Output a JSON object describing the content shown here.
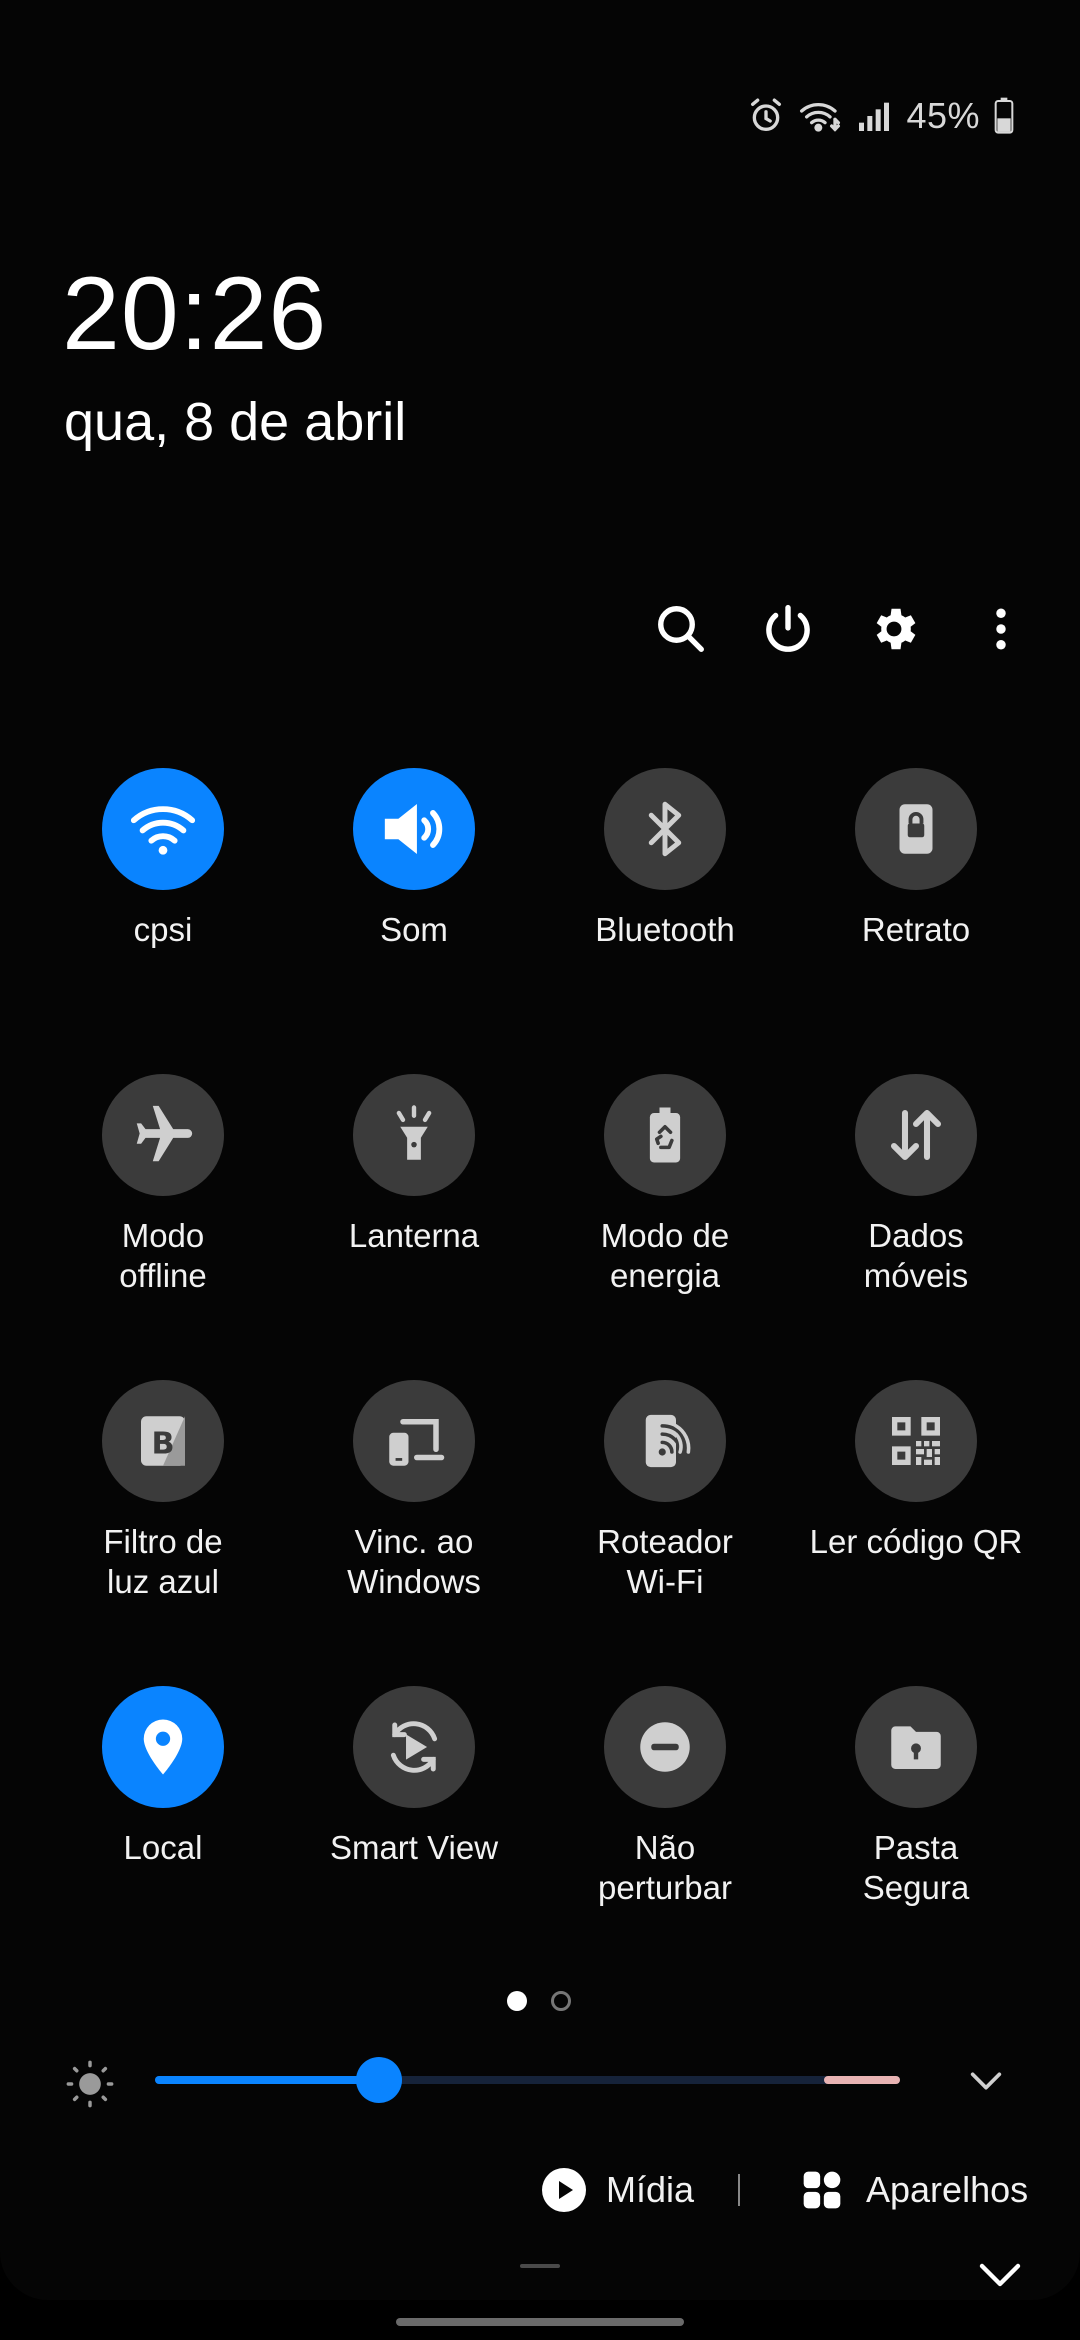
{
  "status_bar": {
    "battery_percent": "45%",
    "battery_level": 45,
    "icons": [
      "alarm-icon",
      "wifi-icon",
      "cell-signal-icon",
      "battery-icon"
    ]
  },
  "lockscreen": {
    "time": "20:26",
    "date": "qua, 8 de abril"
  },
  "quick_actions": {
    "icons": [
      "search-icon",
      "power-icon",
      "settings-icon",
      "more-icon"
    ]
  },
  "tiles": [
    {
      "label": "cpsi",
      "icon": "wifi-icon",
      "active": true
    },
    {
      "label": "Som",
      "icon": "volume-icon",
      "active": true
    },
    {
      "label": "Bluetooth",
      "icon": "bluetooth-icon",
      "active": false
    },
    {
      "label": "Retrato",
      "icon": "portrait-lock-icon",
      "active": false
    },
    {
      "label": "Modo\noffline",
      "icon": "airplane-icon",
      "active": false
    },
    {
      "label": "Lanterna",
      "icon": "flashlight-icon",
      "active": false
    },
    {
      "label": "Modo de\nenergia",
      "icon": "power-mode-icon",
      "active": false
    },
    {
      "label": "Dados\nmóveis",
      "icon": "mobile-data-icon",
      "active": false
    },
    {
      "label": "Filtro de\nluz azul",
      "icon": "blue-light-filter-icon",
      "active": false
    },
    {
      "label": "Vinc. ao\nWindows",
      "icon": "link-to-windows-icon",
      "active": false
    },
    {
      "label": "Roteador\nWi-Fi",
      "icon": "hotspot-icon",
      "active": false
    },
    {
      "label": "Ler código QR",
      "icon": "qr-code-icon",
      "active": false
    },
    {
      "label": "Local",
      "icon": "location-icon",
      "active": true
    },
    {
      "label": "Smart View",
      "icon": "smart-view-icon",
      "active": false
    },
    {
      "label": "Não\nperturbar",
      "icon": "do-not-disturb-icon",
      "active": false
    },
    {
      "label": "Pasta\nSegura",
      "icon": "secure-folder-icon",
      "active": false
    }
  ],
  "pager": {
    "current": 1,
    "total": 2
  },
  "brightness": {
    "level": 0.3
  },
  "media": {
    "label": "Mídia"
  },
  "devices": {
    "label": "Aparelhos"
  },
  "colors": {
    "accent": "#0a84ff",
    "tile_off": "#3b3b3b",
    "background": "#050505"
  }
}
